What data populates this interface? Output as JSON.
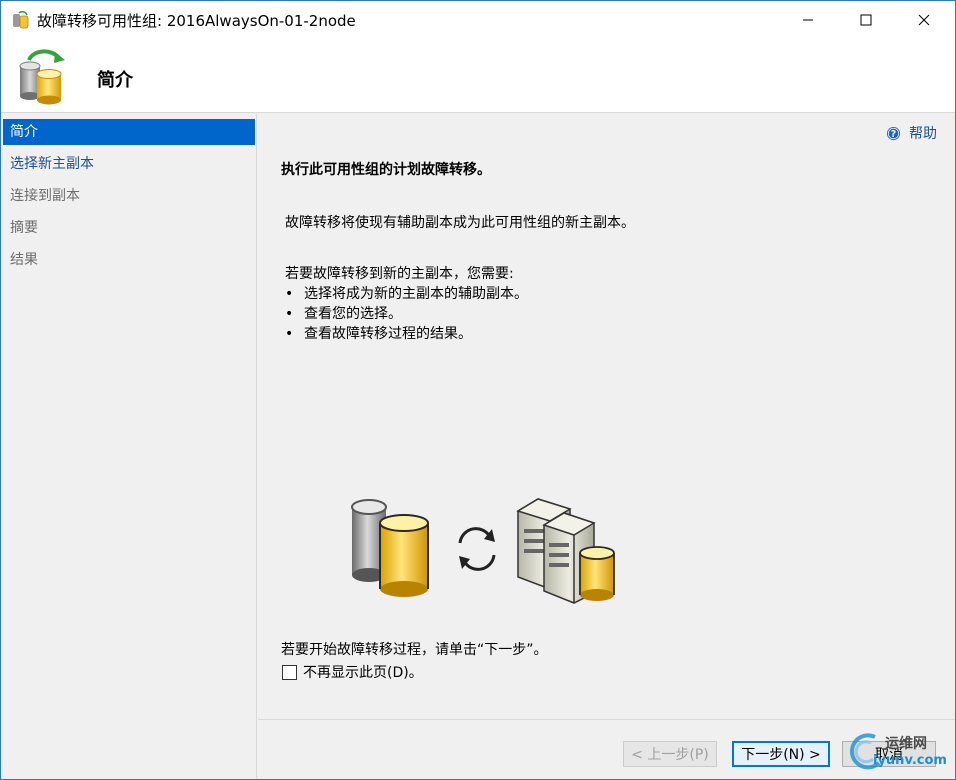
{
  "window": {
    "title": "故障转移可用性组: 2016AlwaysOn-01-2node",
    "icons": [
      "app-icon",
      "minimize-icon",
      "maximize-icon",
      "close-icon"
    ]
  },
  "header": {
    "title": "简介",
    "icon": "database-failover-icon"
  },
  "sidebar": {
    "items": [
      {
        "label": "简介",
        "state": "active"
      },
      {
        "label": "选择新主副本",
        "state": "link"
      },
      {
        "label": "连接到副本",
        "state": "disabled"
      },
      {
        "label": "摘要",
        "state": "disabled"
      },
      {
        "label": "结果",
        "state": "disabled"
      }
    ]
  },
  "content": {
    "help_label": "帮助",
    "heading": "执行此可用性组的计划故障转移。",
    "description": "故障转移将使现有辅助副本成为此可用性组的新主副本。",
    "intro": "若要故障转移到新的主副本，您需要:",
    "bullets": [
      "选择将成为新的主副本的辅助副本。",
      "查看您的选择。",
      "查看故障转移过程的结果。"
    ],
    "bullet_char": "•",
    "hint": "若要开始故障转移过程，请单击“下一步”。",
    "checkbox_label": "不再显示此页(D)。",
    "checkbox_checked": false
  },
  "footer": {
    "prev_label": "< 上一步(P)",
    "next_label": "下一步(N) >",
    "cancel_label": "取消"
  },
  "watermark": {
    "line1": "运维网",
    "line2": "iyunv.com"
  },
  "colors": {
    "accent": "#0066cc",
    "link": "#1f4e99",
    "border": "#2b79c9"
  }
}
